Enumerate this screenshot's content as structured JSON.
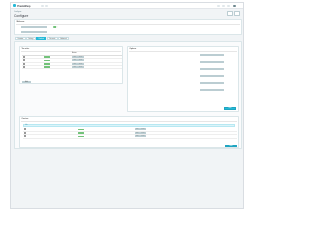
{
  "app": {
    "brand": "PrestaShop"
  },
  "breadcrumb": "Configure",
  "page_title": "Configure",
  "panel_top": {
    "title": "Welcome"
  },
  "tabs": [
    {
      "label": "Overview"
    },
    {
      "label": "Settings"
    },
    {
      "label": "Products"
    },
    {
      "label": "Discounts"
    },
    {
      "label": "Advanced"
    }
  ],
  "panel_left": {
    "title": "Tax rules",
    "columns": [
      "",
      "",
      "",
      "",
      "Actions"
    ],
    "rows": [
      {
        "status": "Enabled",
        "a": "Edit",
        "b": "Delete"
      },
      {
        "status": "Enabled",
        "a": "Edit",
        "b": "Delete"
      },
      {
        "status": "Enabled",
        "a": "Edit",
        "b": "Delete"
      },
      {
        "status": "Enabled",
        "a": "Edit",
        "b": "Delete"
      }
    ],
    "add_label": "Add"
  },
  "panel_right": {
    "title": "Options",
    "save_label": "Save"
  },
  "panel_bottom": {
    "title": "Carriers",
    "info": "Info",
    "rows": [
      {
        "status": "Enabled",
        "a": "Edit",
        "b": "Delete"
      },
      {
        "status": "Enabled",
        "a": "Edit",
        "b": "Delete"
      },
      {
        "status": "Enabled",
        "a": "Edit",
        "b": "Delete"
      }
    ],
    "save_label": "Save"
  },
  "colors": {
    "accent": "#25b9d7",
    "success": "#72c279"
  }
}
